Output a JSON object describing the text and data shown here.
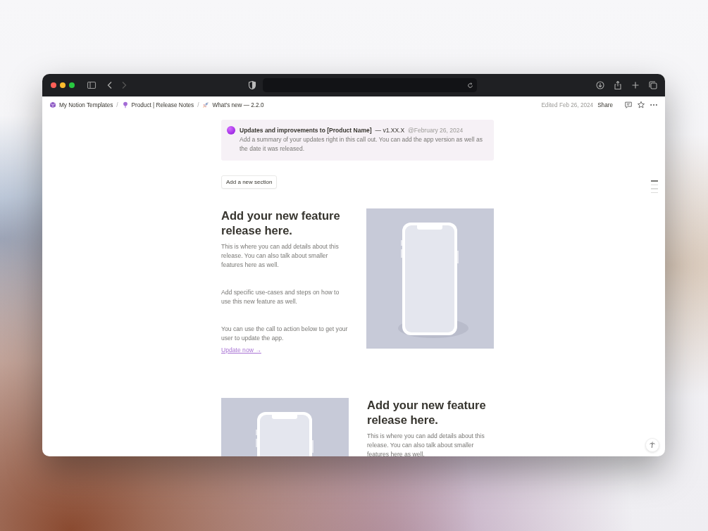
{
  "browser": {
    "traffic_lights": [
      {
        "color": "#ff5f57"
      },
      {
        "color": "#febc2e"
      },
      {
        "color": "#28c840"
      }
    ]
  },
  "breadcrumbs": [
    {
      "label": "My Notion Templates"
    },
    {
      "label": "Product | Release Notes"
    },
    {
      "label": "What's new — 2.2.0"
    }
  ],
  "separator": "/",
  "topbar": {
    "edited": "Edited Feb 26, 2024",
    "share": "Share"
  },
  "callout": {
    "title": "Updates and improvements to [Product Name]",
    "version": "— v1.XX.X",
    "date": "@February 26, 2024",
    "body": "Add a summary of your updates right in this call out. You can add the app version as well as the date it was released."
  },
  "add_section_button": "Add a new section",
  "outline": [
    {
      "selected": true
    },
    {
      "selected": false
    },
    {
      "selected": false
    },
    {
      "selected": false
    }
  ],
  "sections": [
    {
      "kind": "text-left",
      "heading": "Add your new feature release here.",
      "paragraphs": [
        "This is where you can add details about this release. You can also talk about smaller features here as well.",
        "Add specific use-cases and steps on how to use this new feature as well.",
        "You can use the call to action below to get your user to update the app."
      ],
      "link": "Update now →"
    },
    {
      "kind": "image-left",
      "heading": "Add your new feature release here.",
      "paragraphs": [
        "This is where you can add details about this release. You can also talk about smaller features here as well."
      ]
    }
  ]
}
